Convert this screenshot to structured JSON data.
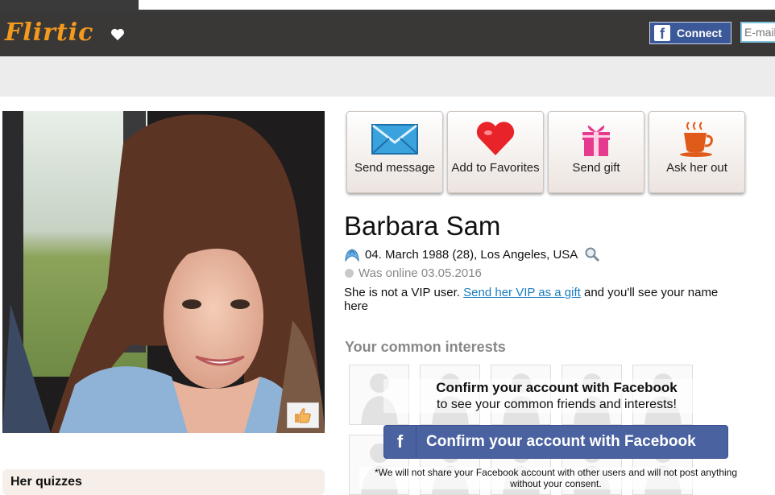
{
  "header": {
    "logo_text": "Flirtic",
    "facebook_connect_label": "Connect",
    "email_placeholder": "E-mail"
  },
  "actions": [
    {
      "label": "Send message",
      "icon": "envelope-icon"
    },
    {
      "label": "Add to Favorites",
      "icon": "heart-icon"
    },
    {
      "label": "Send gift",
      "icon": "gift-icon"
    },
    {
      "label": "Ask her out",
      "icon": "coffee-cup-icon"
    }
  ],
  "profile": {
    "name": "Barbara Sam",
    "birth_info": "04. March 1988 (28), Los Angeles, USA",
    "online_status": "Was online 03.05.2016",
    "vip_prefix": "She is not a VIP user. ",
    "vip_link": "Send her VIP as a gift",
    "vip_suffix": " and you'll see your name here"
  },
  "interests": {
    "title": "Your common interests",
    "overlay_line1": "Confirm your account with Facebook",
    "overlay_line2": "to see your common friends and interests!",
    "confirm_button": "Confirm your account with Facebook",
    "disclaimer": "*We will not share your Facebook account with other users and will not post anything without your consent."
  },
  "quizzes": {
    "title": "Her quizzes"
  },
  "colors": {
    "logo": "#f39a1e",
    "header_bg": "#3a3837",
    "facebook": "#3b5998",
    "link": "#1a7dc0"
  }
}
